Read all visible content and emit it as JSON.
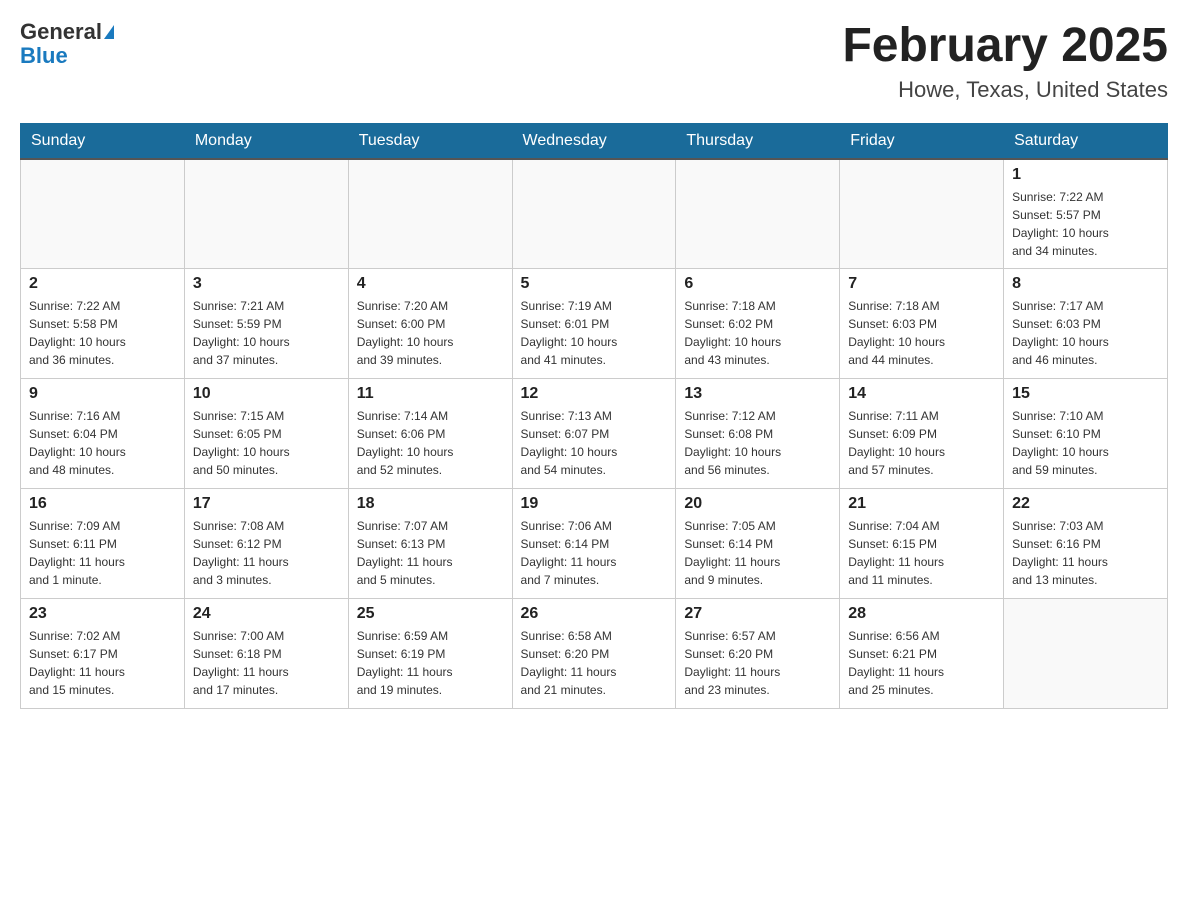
{
  "header": {
    "logo_general": "General",
    "logo_blue": "Blue",
    "month_title": "February 2025",
    "location": "Howe, Texas, United States"
  },
  "days_of_week": [
    "Sunday",
    "Monday",
    "Tuesday",
    "Wednesday",
    "Thursday",
    "Friday",
    "Saturday"
  ],
  "weeks": [
    {
      "days": [
        {
          "number": "",
          "info": ""
        },
        {
          "number": "",
          "info": ""
        },
        {
          "number": "",
          "info": ""
        },
        {
          "number": "",
          "info": ""
        },
        {
          "number": "",
          "info": ""
        },
        {
          "number": "",
          "info": ""
        },
        {
          "number": "1",
          "info": "Sunrise: 7:22 AM\nSunset: 5:57 PM\nDaylight: 10 hours\nand 34 minutes."
        }
      ]
    },
    {
      "days": [
        {
          "number": "2",
          "info": "Sunrise: 7:22 AM\nSunset: 5:58 PM\nDaylight: 10 hours\nand 36 minutes."
        },
        {
          "number": "3",
          "info": "Sunrise: 7:21 AM\nSunset: 5:59 PM\nDaylight: 10 hours\nand 37 minutes."
        },
        {
          "number": "4",
          "info": "Sunrise: 7:20 AM\nSunset: 6:00 PM\nDaylight: 10 hours\nand 39 minutes."
        },
        {
          "number": "5",
          "info": "Sunrise: 7:19 AM\nSunset: 6:01 PM\nDaylight: 10 hours\nand 41 minutes."
        },
        {
          "number": "6",
          "info": "Sunrise: 7:18 AM\nSunset: 6:02 PM\nDaylight: 10 hours\nand 43 minutes."
        },
        {
          "number": "7",
          "info": "Sunrise: 7:18 AM\nSunset: 6:03 PM\nDaylight: 10 hours\nand 44 minutes."
        },
        {
          "number": "8",
          "info": "Sunrise: 7:17 AM\nSunset: 6:03 PM\nDaylight: 10 hours\nand 46 minutes."
        }
      ]
    },
    {
      "days": [
        {
          "number": "9",
          "info": "Sunrise: 7:16 AM\nSunset: 6:04 PM\nDaylight: 10 hours\nand 48 minutes."
        },
        {
          "number": "10",
          "info": "Sunrise: 7:15 AM\nSunset: 6:05 PM\nDaylight: 10 hours\nand 50 minutes."
        },
        {
          "number": "11",
          "info": "Sunrise: 7:14 AM\nSunset: 6:06 PM\nDaylight: 10 hours\nand 52 minutes."
        },
        {
          "number": "12",
          "info": "Sunrise: 7:13 AM\nSunset: 6:07 PM\nDaylight: 10 hours\nand 54 minutes."
        },
        {
          "number": "13",
          "info": "Sunrise: 7:12 AM\nSunset: 6:08 PM\nDaylight: 10 hours\nand 56 minutes."
        },
        {
          "number": "14",
          "info": "Sunrise: 7:11 AM\nSunset: 6:09 PM\nDaylight: 10 hours\nand 57 minutes."
        },
        {
          "number": "15",
          "info": "Sunrise: 7:10 AM\nSunset: 6:10 PM\nDaylight: 10 hours\nand 59 minutes."
        }
      ]
    },
    {
      "days": [
        {
          "number": "16",
          "info": "Sunrise: 7:09 AM\nSunset: 6:11 PM\nDaylight: 11 hours\nand 1 minute."
        },
        {
          "number": "17",
          "info": "Sunrise: 7:08 AM\nSunset: 6:12 PM\nDaylight: 11 hours\nand 3 minutes."
        },
        {
          "number": "18",
          "info": "Sunrise: 7:07 AM\nSunset: 6:13 PM\nDaylight: 11 hours\nand 5 minutes."
        },
        {
          "number": "19",
          "info": "Sunrise: 7:06 AM\nSunset: 6:14 PM\nDaylight: 11 hours\nand 7 minutes."
        },
        {
          "number": "20",
          "info": "Sunrise: 7:05 AM\nSunset: 6:14 PM\nDaylight: 11 hours\nand 9 minutes."
        },
        {
          "number": "21",
          "info": "Sunrise: 7:04 AM\nSunset: 6:15 PM\nDaylight: 11 hours\nand 11 minutes."
        },
        {
          "number": "22",
          "info": "Sunrise: 7:03 AM\nSunset: 6:16 PM\nDaylight: 11 hours\nand 13 minutes."
        }
      ]
    },
    {
      "days": [
        {
          "number": "23",
          "info": "Sunrise: 7:02 AM\nSunset: 6:17 PM\nDaylight: 11 hours\nand 15 minutes."
        },
        {
          "number": "24",
          "info": "Sunrise: 7:00 AM\nSunset: 6:18 PM\nDaylight: 11 hours\nand 17 minutes."
        },
        {
          "number": "25",
          "info": "Sunrise: 6:59 AM\nSunset: 6:19 PM\nDaylight: 11 hours\nand 19 minutes."
        },
        {
          "number": "26",
          "info": "Sunrise: 6:58 AM\nSunset: 6:20 PM\nDaylight: 11 hours\nand 21 minutes."
        },
        {
          "number": "27",
          "info": "Sunrise: 6:57 AM\nSunset: 6:20 PM\nDaylight: 11 hours\nand 23 minutes."
        },
        {
          "number": "28",
          "info": "Sunrise: 6:56 AM\nSunset: 6:21 PM\nDaylight: 11 hours\nand 25 minutes."
        },
        {
          "number": "",
          "info": ""
        }
      ]
    }
  ]
}
